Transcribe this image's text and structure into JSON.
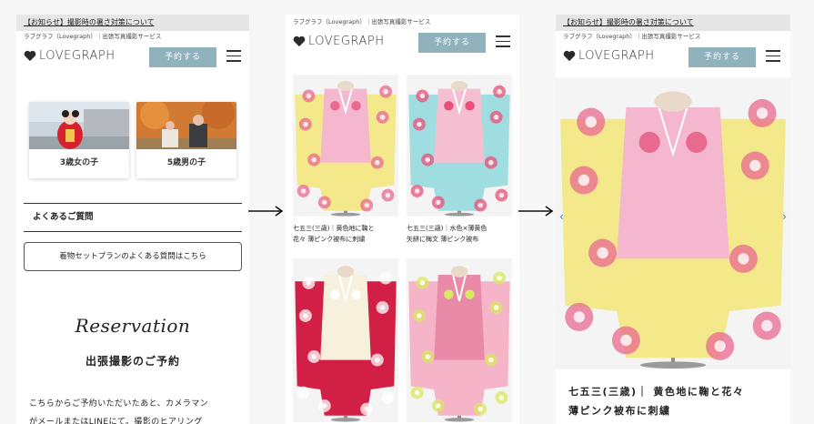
{
  "notice": "【お知らせ】撮影時の暑さ対策について",
  "subline": "ラブグラフ（Lovegraph）｜出張写真撮影サービス",
  "brand": "LOVEGRAPH",
  "reserve_button": "予約する",
  "phone1": {
    "cards": [
      {
        "label": "3歳女の子"
      },
      {
        "label": "5歳男の子"
      }
    ],
    "faq_heading": "よくあるご質問",
    "faq_button": "着物セットプランのよくある質問はこちら",
    "reservation_script": "Reservation",
    "reservation_title": "出張撮影のご予約",
    "body_line1": "こちらからご予約いただいたあと、カメラマン",
    "body_line2": "がメールまたはLINEにて。撮影のヒアリング"
  },
  "phone2": {
    "items": [
      {
        "cap1": "七五三(三歳)｜黄色地に鞠と",
        "cap2": "花々 薄ピンク被布に刺繍",
        "bg": "#f3e88a",
        "coat": "#f4b7cd",
        "accent": "#e86a8f"
      },
      {
        "cap1": "七五三(三歳)｜水色×薄黄色",
        "cap2": "矢絣に梅文 薄ピンク被布",
        "bg": "#9fdde0",
        "coat": "#f5bfd2",
        "accent": "#e8507a"
      },
      {
        "cap1": "",
        "cap2": "",
        "bg": "#d21f45",
        "coat": "#f6f0dc",
        "accent": "#ffffff"
      },
      {
        "cap1": "",
        "cap2": "",
        "bg": "#f5b4c8",
        "coat": "#e98aa9",
        "accent": "#d8e860"
      }
    ]
  },
  "phone3": {
    "title_line1": "七五三(三歳)｜ 黄色地に鞠と花々",
    "title_line2": "薄ピンク被布に刺繍",
    "arrow_left": "‹",
    "arrow_right": "›"
  },
  "colors": {
    "reserve": "#8fb2bd",
    "notice_bg": "#e6e6e6"
  }
}
